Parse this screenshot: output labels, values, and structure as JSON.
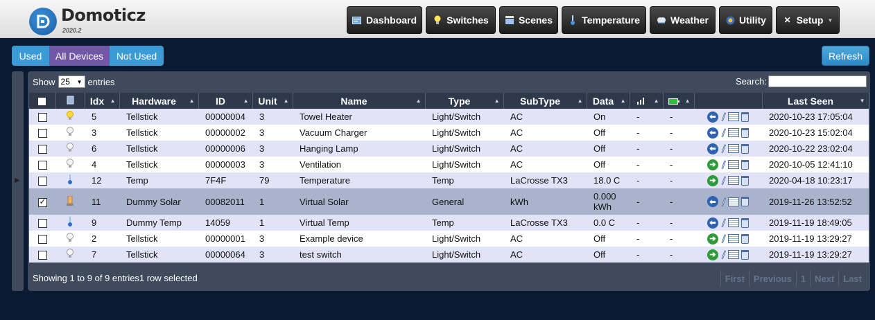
{
  "app": {
    "title": "Domoticz",
    "version": "2020.2"
  },
  "nav": [
    {
      "label": "Dashboard",
      "icon": "dashboard-icon"
    },
    {
      "label": "Switches",
      "icon": "lightbulb-icon"
    },
    {
      "label": "Scenes",
      "icon": "clapper-icon"
    },
    {
      "label": "Temperature",
      "icon": "thermometer-icon"
    },
    {
      "label": "Weather",
      "icon": "cloud-icon"
    },
    {
      "label": "Utility",
      "icon": "utility-icon"
    },
    {
      "label": "Setup",
      "icon": "tools-icon"
    }
  ],
  "filters": {
    "used": "Used",
    "all": "All Devices",
    "not_used": "Not Used"
  },
  "refresh_label": "Refresh",
  "table_controls": {
    "show_label": "Show",
    "page_size": "25",
    "entries_label": "entries",
    "search_label": "Search:"
  },
  "columns": [
    "Idx",
    "Hardware",
    "ID",
    "Unit",
    "Name",
    "Type",
    "SubType",
    "Data",
    "Last Seen"
  ],
  "rows": [
    {
      "checked": false,
      "icon": "bulb-on",
      "idx": "5",
      "hardware": "Tellstick",
      "id": "00000004",
      "unit": "3",
      "name": "Towel Heater",
      "type": "Light/Switch",
      "subtype": "AC",
      "data": "On",
      "signal": "-",
      "battery": "-",
      "action": "blue",
      "last_seen": "2020-10-23 17:05:04"
    },
    {
      "checked": false,
      "icon": "bulb-off",
      "idx": "3",
      "hardware": "Tellstick",
      "id": "00000002",
      "unit": "3",
      "name": "Vacuum Charger",
      "type": "Light/Switch",
      "subtype": "AC",
      "data": "Off",
      "signal": "-",
      "battery": "-",
      "action": "blue",
      "last_seen": "2020-10-23 15:02:04"
    },
    {
      "checked": false,
      "icon": "bulb-off",
      "idx": "6",
      "hardware": "Tellstick",
      "id": "00000006",
      "unit": "3",
      "name": "Hanging Lamp",
      "type": "Light/Switch",
      "subtype": "AC",
      "data": "Off",
      "signal": "-",
      "battery": "-",
      "action": "blue",
      "last_seen": "2020-10-22 23:02:04"
    },
    {
      "checked": false,
      "icon": "bulb-off",
      "idx": "4",
      "hardware": "Tellstick",
      "id": "00000003",
      "unit": "3",
      "name": "Ventilation",
      "type": "Light/Switch",
      "subtype": "AC",
      "data": "Off",
      "signal": "-",
      "battery": "-",
      "action": "green",
      "last_seen": "2020-10-05 12:41:10"
    },
    {
      "checked": false,
      "icon": "thermo",
      "idx": "12",
      "hardware": "Temp",
      "id": "7F4F",
      "unit": "79",
      "name": "Temperature",
      "type": "Temp",
      "subtype": "LaCrosse TX3",
      "data": "18.0 C",
      "signal": "-",
      "battery": "-",
      "action": "green",
      "last_seen": "2020-04-18 10:23:17"
    },
    {
      "checked": true,
      "icon": "counter",
      "idx": "11",
      "hardware": "Dummy Solar",
      "id": "00082011",
      "unit": "1",
      "name": "Virtual Solar",
      "type": "General",
      "subtype": "kWh",
      "data": "0.000 kWh",
      "signal": "-",
      "battery": "-",
      "action": "blue",
      "last_seen": "2019-11-26 13:52:52"
    },
    {
      "checked": false,
      "icon": "thermo",
      "idx": "9",
      "hardware": "Dummy Temp",
      "id": "14059",
      "unit": "1",
      "name": "Virtual Temp",
      "type": "Temp",
      "subtype": "LaCrosse TX3",
      "data": "0.0 C",
      "signal": "-",
      "battery": "-",
      "action": "blue",
      "last_seen": "2019-11-19 18:49:05"
    },
    {
      "checked": false,
      "icon": "bulb-off",
      "idx": "2",
      "hardware": "Tellstick",
      "id": "00000001",
      "unit": "3",
      "name": "Example device",
      "type": "Light/Switch",
      "subtype": "AC",
      "data": "Off",
      "signal": "-",
      "battery": "-",
      "action": "green",
      "last_seen": "2019-11-19 13:29:27"
    },
    {
      "checked": false,
      "icon": "bulb-off",
      "idx": "7",
      "hardware": "Tellstick",
      "id": "00000064",
      "unit": "3",
      "name": "test switch",
      "type": "Light/Switch",
      "subtype": "AC",
      "data": "Off",
      "signal": "-",
      "battery": "-",
      "action": "green",
      "last_seen": "2019-11-19 13:29:27"
    }
  ],
  "footer": {
    "info": "Showing 1 to 9 of 9 entries1 row selected"
  },
  "pager": {
    "first": "First",
    "previous": "Previous",
    "page": "1",
    "next": "Next",
    "last": "Last"
  },
  "colors": {
    "background": "#0b1a33",
    "panel": "#3f4a5d",
    "row_odd": "#e3e3f8",
    "row_selected": "#a9b4cc",
    "active_filter": "#7058a6",
    "button_blue": "#3b9bd6"
  }
}
